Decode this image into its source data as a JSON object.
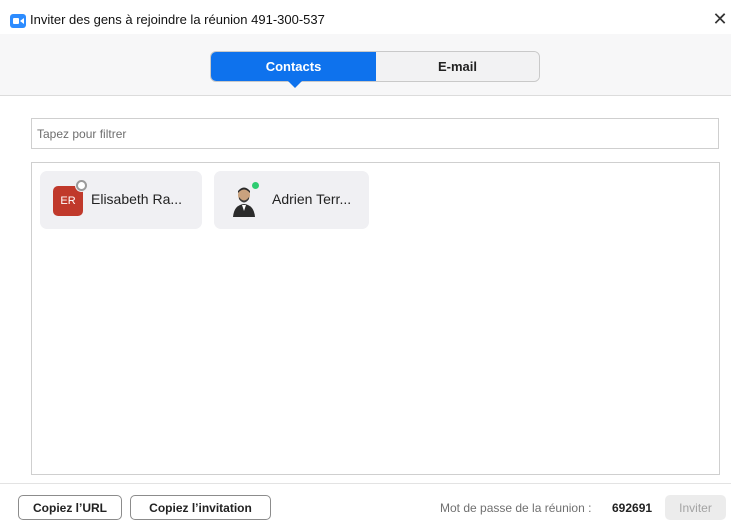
{
  "window": {
    "title": "Inviter des gens à rejoindre la réunion 491-300-537",
    "close_glyph": "✕"
  },
  "tabs": {
    "items": [
      {
        "label": "Contacts",
        "active": true
      },
      {
        "label": "E-mail",
        "active": false
      }
    ]
  },
  "filter": {
    "placeholder": "Tapez pour filtrer",
    "value": ""
  },
  "contacts": [
    {
      "initials": "ER",
      "name": "Elisabeth Ra...",
      "status": "away",
      "avatar_color": "#c0392b"
    },
    {
      "name": "Adrien Terr...",
      "status": "online",
      "avatar": "photo"
    }
  ],
  "footer": {
    "copy_url_label": "Copiez l’URL",
    "copy_invitation_label": "Copiez l’invitation",
    "password_label": "Mot de passe de la réunion :",
    "password_value": "692691",
    "invite_label": "Inviter"
  },
  "colors": {
    "accent": "#0e72ed",
    "online": "#2ecc71",
    "initials_bg": "#c0392b"
  }
}
